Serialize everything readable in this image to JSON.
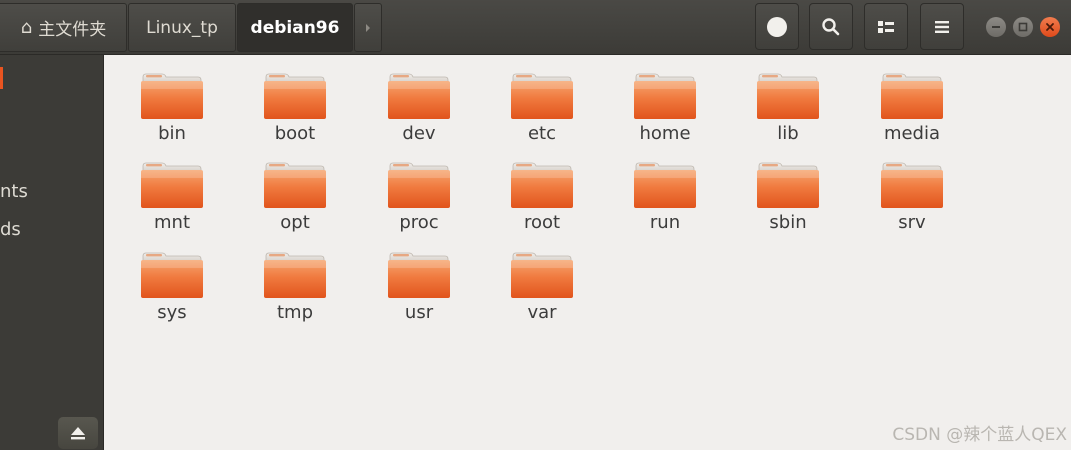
{
  "window": {
    "controls": {
      "minimize_icon": "minimize-icon",
      "maximize_icon": "maximize-icon",
      "close_icon": "close-icon"
    }
  },
  "breadcrumb": {
    "home_icon": "home-icon",
    "home_label": "主文件夹",
    "items": [
      "Linux_tp",
      "debian96"
    ],
    "active": "debian96",
    "next_icon": "chevron-right-icon"
  },
  "toolbar": {
    "buttons": [
      "record-icon",
      "search-icon",
      "view-toggle-icon",
      "menu-icon"
    ]
  },
  "sidebar": {
    "visible_labels": [
      "nts",
      "ds"
    ],
    "eject_icon": "eject-icon",
    "accent_color": "#e95420"
  },
  "folders": [
    "bin",
    "boot",
    "dev",
    "etc",
    "home",
    "lib",
    "media",
    "mnt",
    "opt",
    "proc",
    "root",
    "run",
    "sbin",
    "srv",
    "sys",
    "tmp",
    "usr",
    "var"
  ],
  "colors": {
    "header_bg": "#3c3b37",
    "sidebar_bg": "#3c3b37",
    "content_bg": "#f1efed",
    "folder_orange": "#e95420",
    "close_button": "#e7531f"
  },
  "watermark": "CSDN @辣个蓝人QEX"
}
